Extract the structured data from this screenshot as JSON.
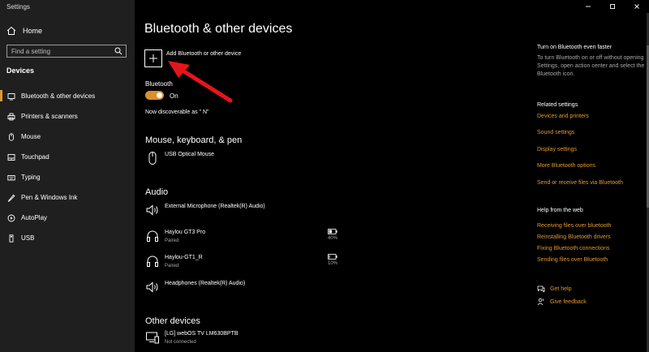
{
  "window": {
    "title": "Settings"
  },
  "sidebar": {
    "home_label": "Home",
    "search_placeholder": "Find a setting",
    "section_label": "Devices",
    "items": [
      {
        "label": "Bluetooth & other devices",
        "icon": "bluetooth-icon",
        "active": true
      },
      {
        "label": "Printers & scanners",
        "icon": "printer-icon"
      },
      {
        "label": "Mouse",
        "icon": "mouse-icon"
      },
      {
        "label": "Touchpad",
        "icon": "touchpad-icon"
      },
      {
        "label": "Typing",
        "icon": "keyboard-icon"
      },
      {
        "label": "Pen & Windows Ink",
        "icon": "pen-icon"
      },
      {
        "label": "AutoPlay",
        "icon": "autoplay-icon"
      },
      {
        "label": "USB",
        "icon": "usb-icon"
      }
    ]
  },
  "main": {
    "title": "Bluetooth & other devices",
    "add_device_label": "Add Bluetooth or other device",
    "bluetooth": {
      "label": "Bluetooth",
      "state": "On",
      "discoverable": "Now discoverable as \"     N\""
    },
    "sections": {
      "mouse_keyboard_pen": {
        "heading": "Mouse, keyboard, & pen",
        "devices": [
          {
            "name": "USB Optical Mouse",
            "icon": "mouse-icon"
          }
        ]
      },
      "audio": {
        "heading": "Audio",
        "devices": [
          {
            "name": "External Microphone (Realtek(R) Audio)",
            "icon": "speaker-icon"
          },
          {
            "name": "Haylou GT3 Pro",
            "status": "Paired",
            "battery": "40%",
            "icon": "headphones-icon"
          },
          {
            "name": "Haylou-GT1_R",
            "status": "Paired",
            "battery": "10%",
            "icon": "headphones-icon"
          },
          {
            "name": "Headphones (Realtek(R) Audio)",
            "icon": "speaker-icon"
          }
        ]
      },
      "other": {
        "heading": "Other devices",
        "devices": [
          {
            "name": "[LG] webOS TV LM630BPTB",
            "status": "Not connected",
            "icon": "tv-icon"
          }
        ]
      }
    }
  },
  "right_panel": {
    "tip_heading": "Turn on Bluetooth even faster",
    "tip_text": "To turn Bluetooth on or off without opening Settings, open action center and select the Bluetooth icon.",
    "related_heading": "Related settings",
    "related_links": [
      "Devices and printers",
      "Sound settings",
      "Display settings",
      "More Bluetooth options",
      "Send or receive files via Bluetooth"
    ],
    "help_heading": "Help from the web",
    "help_links": [
      "Receiving files over bluetooth",
      "Reinstalling Bluetooth drivers",
      "Fixing Bluetooth connections",
      "Sending files over Bluetooth"
    ],
    "get_help": "Get help",
    "give_feedback": "Give feedback"
  },
  "colors": {
    "accent": "#e0982f",
    "sidebar_bg": "#1f1f1f",
    "main_bg": "#000000",
    "annotation_arrow": "#e8141b"
  }
}
